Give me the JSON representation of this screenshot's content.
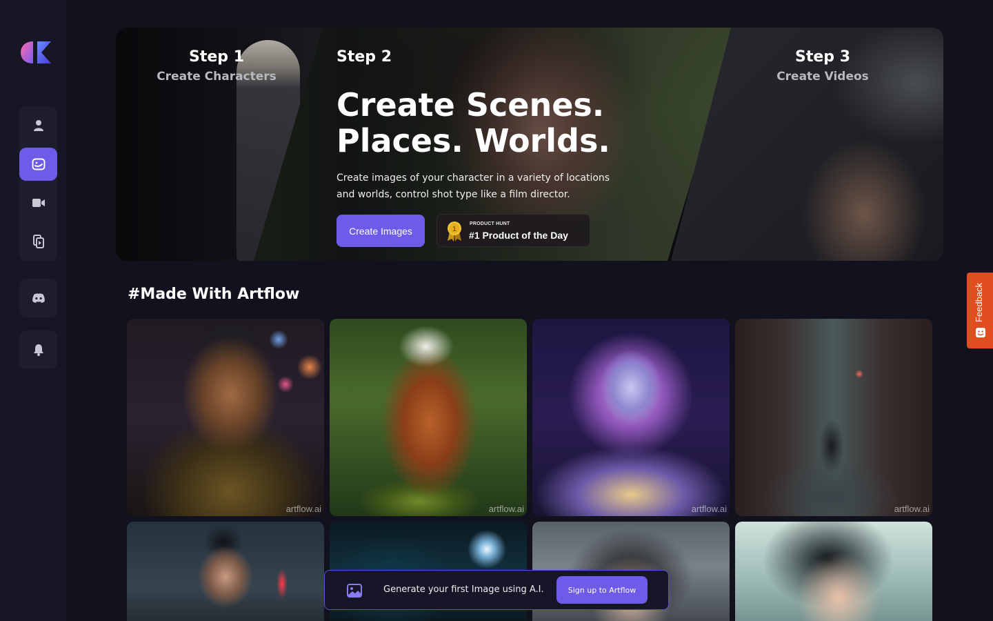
{
  "sidebar": {
    "logo_icon": "artflow-logo",
    "items": [
      {
        "icon": "user-icon",
        "label": "Characters"
      },
      {
        "icon": "smile-icon",
        "label": "Scenes",
        "active": true
      },
      {
        "icon": "video-icon",
        "label": "Videos"
      },
      {
        "icon": "copy-icon",
        "label": "Library"
      }
    ],
    "discord_icon": "discord-icon",
    "bell_icon": "bell-icon"
  },
  "hero": {
    "step1_title": "Step 1",
    "step1_sub": "Create Characters",
    "step2_title": "Step 2",
    "headline_line1": "Create Scenes.",
    "headline_line2": "Places. Worlds.",
    "description": "Create images of your character in a variety of locations and worlds, control shot type like a film director.",
    "cta_label": "Create Images",
    "badge_small": "PRODUCT HUNT",
    "badge_big": "#1 Product of the Day",
    "badge_medal_number": "1",
    "step3_title": "Step 3",
    "step3_sub": "Create Videos"
  },
  "gallery": {
    "title": "#Made With Artflow",
    "watermark": "artflow.ai"
  },
  "cta_bar": {
    "text": "Generate your first Image using A.I.",
    "button_label": "Sign up to Artflow",
    "icon": "image-icon"
  },
  "feedback": {
    "label": "Feedback",
    "accent": "#e04e1f"
  },
  "colors": {
    "accent": "#6c5ce7",
    "background": "#12121f",
    "sidebar": "#161625"
  }
}
